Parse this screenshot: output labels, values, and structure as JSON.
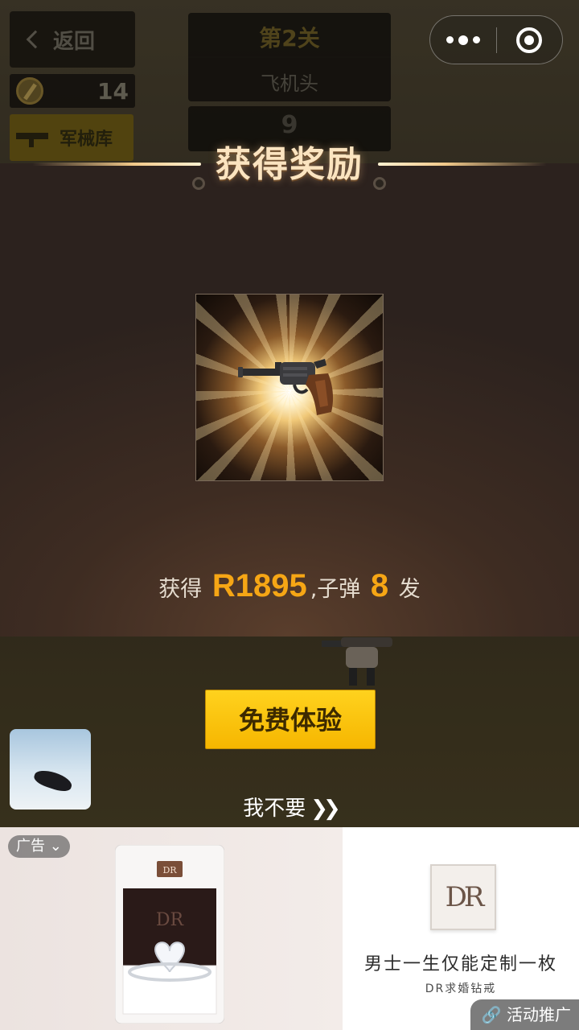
{
  "hud": {
    "back_label": "返回",
    "coins": "14",
    "armory_label": "军械库",
    "level": "第2关",
    "level_name": "飞机头",
    "count": "9"
  },
  "modal": {
    "title": "获得奖励",
    "reward_prefix": "获得",
    "weapon_name": "R1895",
    "ammo_prefix": ",子弹",
    "ammo_count": "8",
    "ammo_suffix": "发",
    "item_icon": "revolver-icon"
  },
  "actions": {
    "free_trial": "免费体验",
    "refuse": "我不要",
    "refuse_icon": "double-chevron-right-icon"
  },
  "ad": {
    "tag": "广告",
    "brand_logo": "DR",
    "line1": "男士一生仅能定制一枚",
    "line2": "DR求婚钻戒",
    "promo": "活动推广"
  },
  "colors": {
    "accent_gold": "#f6a615",
    "button_yellow": "#ffc800",
    "title_text": "#fbe4c0"
  }
}
